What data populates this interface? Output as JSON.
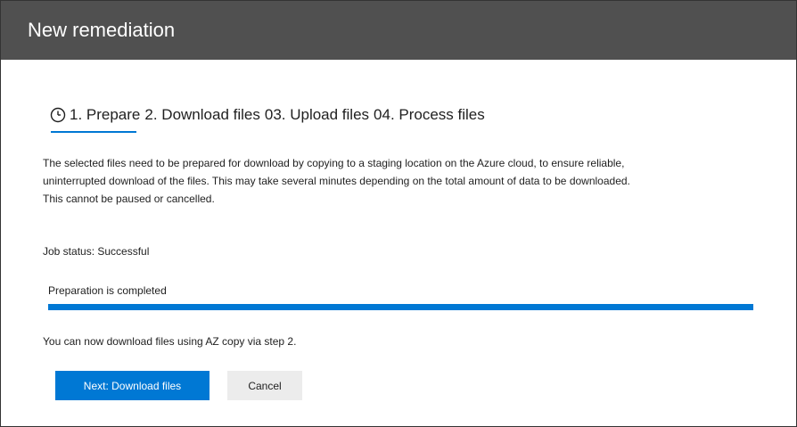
{
  "header": {
    "title": "New remediation"
  },
  "steps": [
    {
      "label": "1. Prepare"
    },
    {
      "label": "2. Download files"
    },
    {
      "label": "03. Upload files"
    },
    {
      "label": "04. Process files"
    }
  ],
  "content": {
    "description_line1": "The selected files need to be prepared for download by copying to a staging location on the Azure cloud, to ensure reliable,",
    "description_line2": "uninterrupted download of the files. This may take several minutes depending on the total amount of data to be downloaded.",
    "description_line3": "This cannot be paused or cancelled.",
    "job_status": "Job status: Successful",
    "preparation_label": "Preparation is completed",
    "progress_fraction": 1.0,
    "next_note": "You can now download files using AZ copy via step 2."
  },
  "buttons": {
    "next_label": "Next: Download files",
    "cancel_label": "Cancel"
  },
  "colors": {
    "header_bg": "#505050",
    "accent": "#0078d4"
  },
  "icons": {
    "step_status": "clock-icon"
  }
}
